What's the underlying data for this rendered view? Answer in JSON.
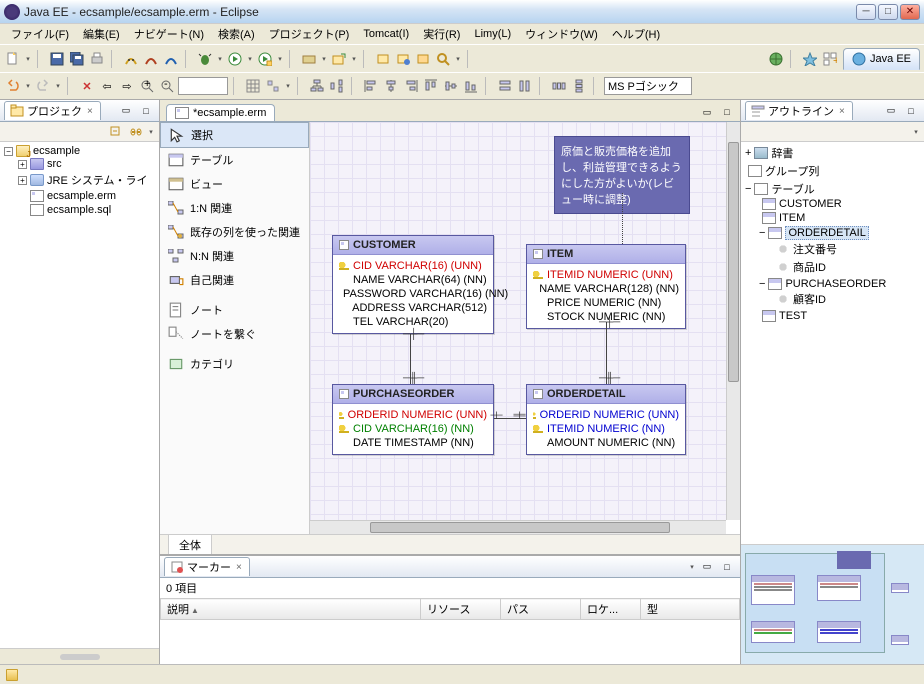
{
  "window": {
    "title": "Java EE - ecsample/ecsample.erm - Eclipse"
  },
  "menu": {
    "file": "ファイル(F)",
    "edit": "編集(E)",
    "navigate": "ナビゲート(N)",
    "search": "検索(A)",
    "project": "プロジェクト(P)",
    "tomcat": "Tomcat(I)",
    "run": "実行(R)",
    "limy": "Limy(L)",
    "window": "ウィンドウ(W)",
    "help": "ヘルプ(H)"
  },
  "perspective": {
    "javaee": "Java EE"
  },
  "toolbar": {
    "font_name": "MS Pゴシック"
  },
  "project_view": {
    "title": "プロジェク",
    "root": "ecsample",
    "src": "src",
    "jre": "JRE システム・ライ",
    "erm": "ecsample.erm",
    "sql": "ecsample.sql"
  },
  "editor": {
    "tab": "*ecsample.erm",
    "footer": "全体"
  },
  "palette": {
    "select": "選択",
    "table": "テーブル",
    "view": "ビュー",
    "one_n": "1:N 関連",
    "existing_col": "既存の列を使った関連",
    "n_n": "N:N 関連",
    "self_rel": "自己関連",
    "note": "ノート",
    "note_link": "ノートを繋ぐ",
    "category": "カテゴリ"
  },
  "diagram": {
    "note_text": "原価と販売価格を追加し、利益管理できるようにした方がよいか(レビュー時に調整)",
    "customer": {
      "name": "CUSTOMER",
      "cols": [
        "CID VARCHAR(16) (UNN)",
        "NAME VARCHAR(64) (NN)",
        "PASSWORD VARCHAR(16) (NN)",
        "ADDRESS VARCHAR(512)",
        "TEL VARCHAR(20)"
      ]
    },
    "item": {
      "name": "ITEM",
      "cols": [
        "ITEMID NUMERIC (UNN)",
        "NAME VARCHAR(128) (NN)",
        "PRICE NUMERIC (NN)",
        "STOCK NUMERIC (NN)"
      ]
    },
    "purchaseorder": {
      "name": "PURCHASEORDER",
      "cols": [
        "ORDERID NUMERIC (UNN)",
        "CID VARCHAR(16) (NN)",
        "DATE TIMESTAMP (NN)"
      ]
    },
    "orderdetail": {
      "name": "ORDERDETAIL",
      "cols": [
        "ORDERID NUMERIC (UNN)",
        "ITEMID NUMERIC (NN)",
        "AMOUNT NUMERIC (NN)"
      ]
    }
  },
  "outline": {
    "title": "アウトライン",
    "dict": "辞書",
    "groups": "グループ列",
    "tables": "テーブル",
    "t_customer": "CUSTOMER",
    "t_item": "ITEM",
    "t_orderdetail": "ORDERDETAIL",
    "od_col1": "注文番号",
    "od_col2": "商品ID",
    "t_purchaseorder": "PURCHASEORDER",
    "po_col1": "顧客ID",
    "t_test": "TEST"
  },
  "markers": {
    "title": "マーカー",
    "count": "0 項目",
    "col_desc": "説明",
    "col_res": "リソース",
    "col_path": "パス",
    "col_loc": "ロケ...",
    "col_type": "型"
  }
}
